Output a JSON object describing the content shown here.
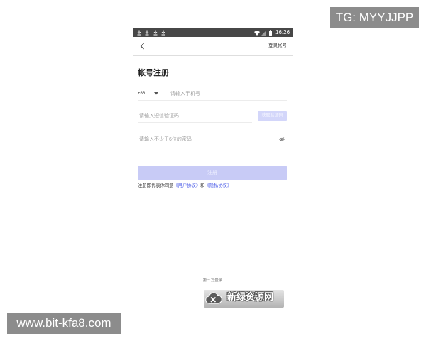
{
  "overlays": {
    "top_right_tag": "TG: MYYJJPP",
    "bottom_left_url": "www.bit-kfa8.com"
  },
  "status_bar": {
    "time": "16:26",
    "left_icons": [
      "download-icon",
      "download-icon",
      "download-icon",
      "download-icon"
    ],
    "right_icons": [
      "wifi-icon",
      "signal-icon",
      "battery-icon"
    ]
  },
  "header": {
    "back_icon": "chevron-left-icon",
    "login_link": "登录帐号"
  },
  "page_title": "帐号注册",
  "form": {
    "country_code": "+86",
    "country_icon": "caret-down-icon",
    "phone_placeholder": "请输入手机号",
    "code_placeholder": "请输入短信验证码",
    "get_code_label": "获取验证码",
    "password_placeholder": "请输入不少于6位的密码",
    "password_toggle_icon": "eye-off-icon",
    "register_label": "注册"
  },
  "agreement": {
    "prefix": "注册即代表你同意",
    "user_agreement": "《用户协议》",
    "conjunction": "和",
    "privacy_agreement": "《隐私协议》"
  },
  "third_party": {
    "label": "第三方登录"
  },
  "watermark": {
    "logo_icon": "cloud-logo-icon",
    "logo_text": "新绿资源网"
  },
  "colors": {
    "status_bar": "#474747",
    "button_disabled": "#c8cbf6",
    "code_button": "#d3d6fa",
    "link": "#4a5be8",
    "overlay_bg": "#8c8c8c"
  }
}
